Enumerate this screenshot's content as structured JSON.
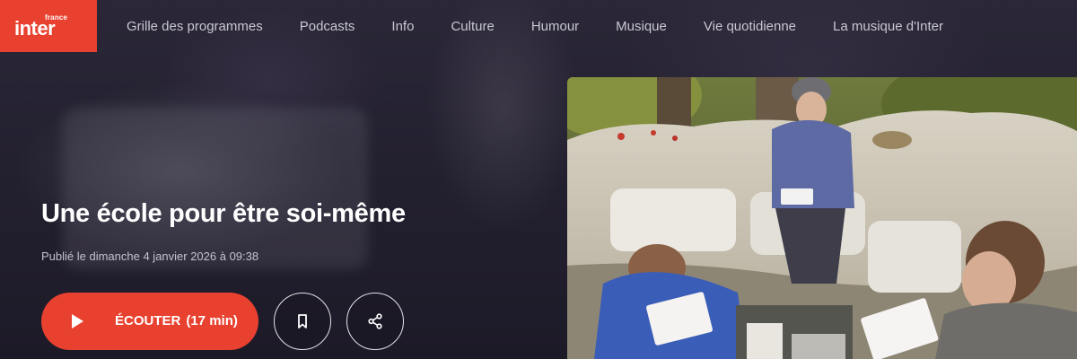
{
  "brand": {
    "small": "france",
    "main": "inter"
  },
  "nav": {
    "items": [
      "Grille des programmes",
      "Podcasts",
      "Info",
      "Culture",
      "Humour",
      "Musique",
      "Vie quotidienne",
      "La musique d'Inter"
    ]
  },
  "episode": {
    "title": "Une école pour être soi-même",
    "published": "Publié le dimanche 4 janvier 2026 à 09:38"
  },
  "actions": {
    "listen_label": "ÉCOUTER",
    "listen_duration": "(17 min)",
    "bookmark_icon": "bookmark-icon",
    "share_icon": "share-icon"
  },
  "colors": {
    "accent": "#e8412f",
    "background": "#1f1c2c"
  }
}
